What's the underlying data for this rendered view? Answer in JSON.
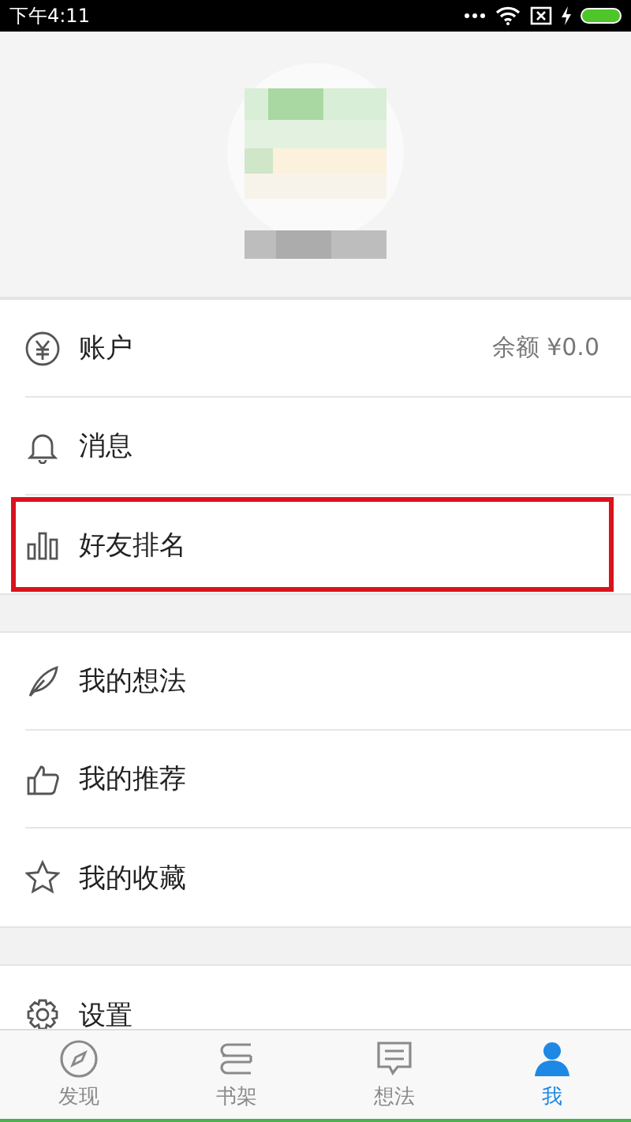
{
  "status_bar": {
    "time": "下午4:11"
  },
  "sections": [
    {
      "items": [
        {
          "label": "账户",
          "value": "余额 ¥0.0",
          "highlighted": false
        },
        {
          "label": "消息",
          "highlighted": false
        },
        {
          "label": "好友排名",
          "highlighted": true
        }
      ]
    },
    {
      "items": [
        {
          "label": "我的想法",
          "highlighted": false
        },
        {
          "label": "我的推荐",
          "highlighted": false
        },
        {
          "label": "我的收藏",
          "highlighted": false
        }
      ]
    },
    {
      "items": [
        {
          "label": "设置",
          "highlighted": false
        }
      ]
    }
  ],
  "tabs": [
    {
      "label": "发现",
      "selected": false
    },
    {
      "label": "书架",
      "selected": false
    },
    {
      "label": "想法",
      "selected": false
    },
    {
      "label": "我",
      "selected": true
    }
  ]
}
